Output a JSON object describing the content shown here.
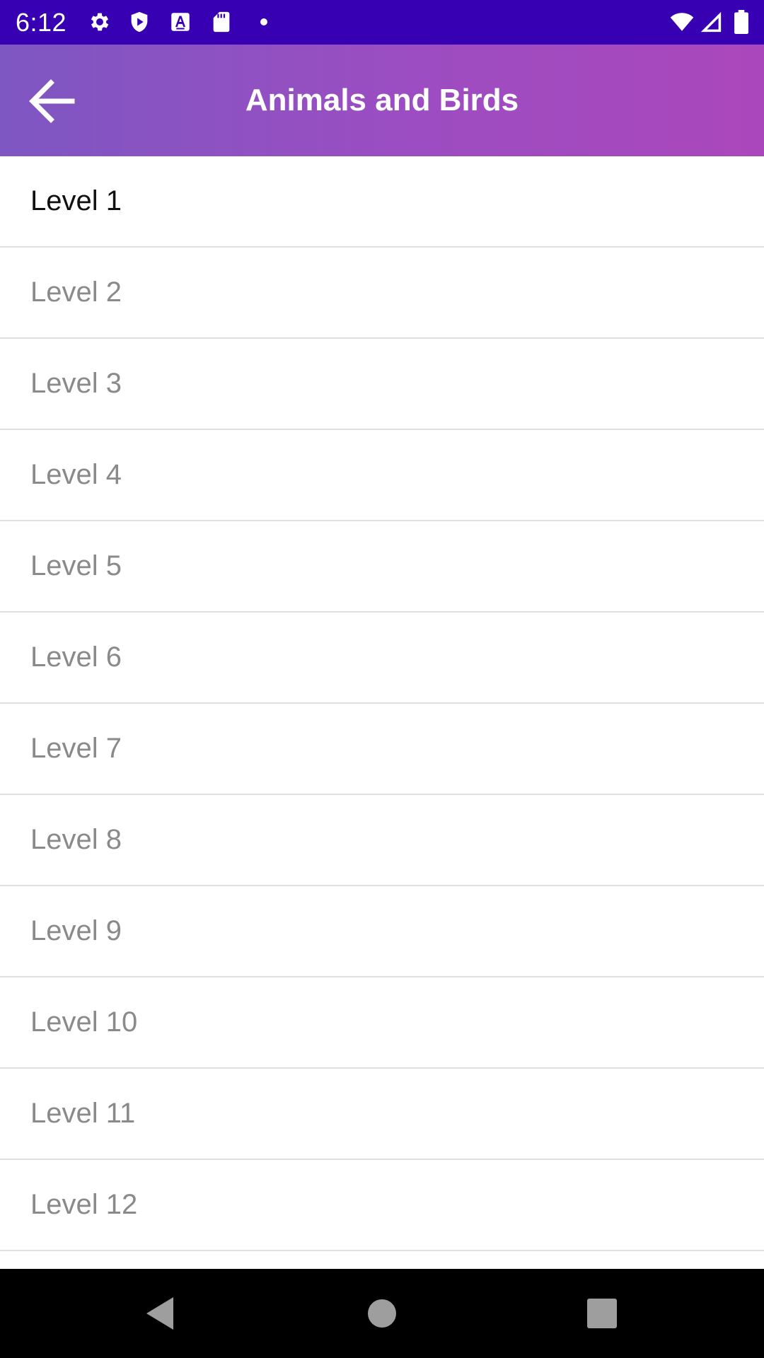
{
  "status_bar": {
    "time": "6:12",
    "left_icons": [
      "gear-icon",
      "play-shield-icon",
      "font-a-icon",
      "sd-card-icon",
      "dot-icon"
    ],
    "right_icons": [
      "wifi-icon",
      "cell-signal-icon",
      "battery-icon"
    ],
    "background": "#3700b3"
  },
  "app_bar": {
    "title": "Animals and Birds",
    "back_icon": "arrow-back-icon",
    "gradient_start": "#7e57c2",
    "gradient_end": "#ab47bc"
  },
  "levels": {
    "active_index": 0,
    "items": [
      {
        "label": "Level 1"
      },
      {
        "label": "Level 2"
      },
      {
        "label": "Level 3"
      },
      {
        "label": "Level 4"
      },
      {
        "label": "Level 5"
      },
      {
        "label": "Level 6"
      },
      {
        "label": "Level 7"
      },
      {
        "label": "Level 8"
      },
      {
        "label": "Level 9"
      },
      {
        "label": "Level 10"
      },
      {
        "label": "Level 11"
      },
      {
        "label": "Level 12"
      },
      {
        "label": ""
      }
    ]
  },
  "nav_bar": {
    "buttons": [
      "back-triangle-icon",
      "home-circle-icon",
      "recents-square-icon"
    ]
  }
}
